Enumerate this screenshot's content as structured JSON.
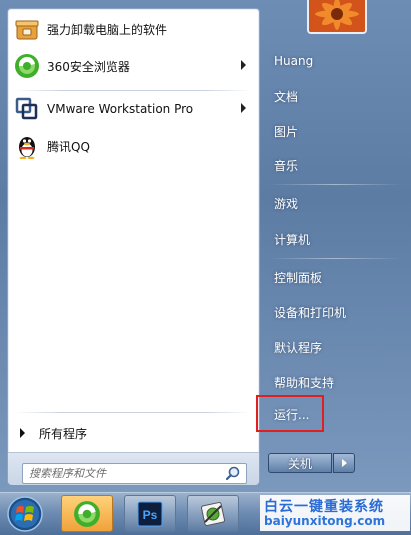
{
  "start_menu": {
    "pinned_programs": [
      {
        "label": "强力卸载电脑上的软件",
        "icon": "uninstaller-box-icon",
        "has_submenu": false
      },
      {
        "label": "360安全浏览器",
        "icon": "360-browser-icon",
        "has_submenu": true
      }
    ],
    "recent_programs": [
      {
        "label": "VMware Workstation Pro",
        "icon": "vmware-icon",
        "has_submenu": true
      },
      {
        "label": "腾讯QQ",
        "icon": "qq-penguin-icon",
        "has_submenu": false
      }
    ],
    "all_programs_label": "所有程序",
    "search": {
      "placeholder": "搜索程序和文件",
      "value": ""
    },
    "right_pane": {
      "user_name": "Huang",
      "items": [
        {
          "label": "文档"
        },
        {
          "label": "图片"
        },
        {
          "label": "音乐"
        },
        {
          "label": "游戏"
        },
        {
          "label": "计算机"
        },
        {
          "label": "控制面板"
        },
        {
          "label": "设备和打印机"
        },
        {
          "label": "默认程序"
        },
        {
          "label": "帮助和支持"
        },
        {
          "label": "运行..."
        }
      ],
      "highlighted_item": "运行..."
    },
    "shutdown_label": "关机"
  },
  "taskbar": {
    "start_button": "windows-start-orb-icon",
    "buttons": [
      {
        "name": "360-browser",
        "icon": "360-browser-icon",
        "active": true
      },
      {
        "name": "photoshop",
        "icon": "photoshop-icon",
        "text": "Ps",
        "active": false
      },
      {
        "name": "tool",
        "icon": "tool-app-icon",
        "active": false
      }
    ]
  },
  "watermark": {
    "title": "白云一键重装系统",
    "url": "baiyunxitong.com"
  },
  "colors": {
    "highlight_border": "#e02020",
    "taskbar_blue": "#6f8db3",
    "menu_frame_blue": "#5c7ca4",
    "watermark_blue": "#2a6bd4"
  }
}
